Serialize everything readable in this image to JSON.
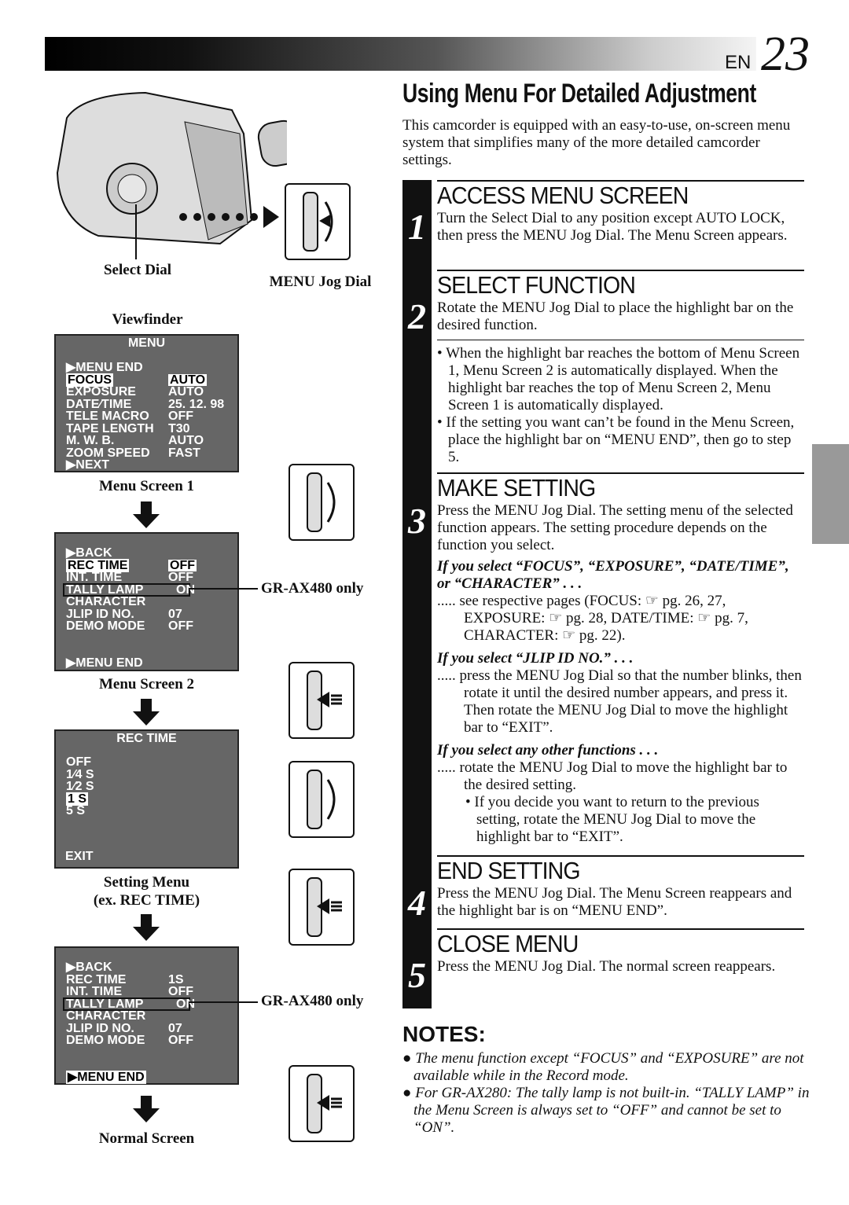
{
  "header": {
    "lang": "EN",
    "page": "23"
  },
  "title": "Using Menu For Detailed Adjustment",
  "intro": "This camcorder is equipped with an easy-to-use, on-screen menu system that simplifies many of the more detailed camcorder settings.",
  "figure": {
    "select_dial": "Select Dial",
    "menu_jog_dial": "MENU Jog Dial",
    "viewfinder": "Viewfinder",
    "screen1": {
      "title": "MENU",
      "rows": [
        [
          "▶MENU  END",
          ""
        ],
        [
          "FOCUS",
          "AUTO"
        ],
        [
          "EXPOSURE",
          "AUTO"
        ],
        [
          "DATE⁄TIME",
          "25. 12. 98"
        ],
        [
          "TELE  MACRO",
          "OFF"
        ],
        [
          "TAPE  LENGTH",
          "T30"
        ],
        [
          "M. W. B.",
          "AUTO"
        ],
        [
          "ZOOM SPEED",
          "FAST"
        ],
        [
          "▶NEXT",
          ""
        ]
      ],
      "caption": "Menu Screen 1"
    },
    "screen2": {
      "rows": [
        [
          "▶BACK",
          ""
        ],
        [
          "REC  TIME",
          "OFF"
        ],
        [
          "INT.  TIME",
          "OFF"
        ],
        [
          "TALLY  LAMP",
          "ON"
        ],
        [
          "CHARACTER",
          ""
        ],
        [
          "JLIP  ID  NO.",
          "07"
        ],
        [
          "DEMO  MODE",
          "OFF"
        ]
      ],
      "end": "▶MENU  END",
      "caption": "Menu Screen 2",
      "callout": "GR-AX480 only"
    },
    "screen3": {
      "title": "REC  TIME",
      "rows": [
        "OFF",
        "1⁄4  S",
        "1⁄2  S",
        "1  S",
        "5  S"
      ],
      "end": "EXIT",
      "caption1": "Setting Menu",
      "caption2": "(ex. REC TIME)"
    },
    "screen4": {
      "rows": [
        [
          "▶BACK",
          ""
        ],
        [
          "REC  TIME",
          "1S"
        ],
        [
          "INT.  TIME",
          "OFF"
        ],
        [
          "TALLY  LAMP",
          "ON"
        ],
        [
          "CHARACTER",
          ""
        ],
        [
          "JLIP  ID  NO.",
          "07"
        ],
        [
          "DEMO  MODE",
          "OFF"
        ]
      ],
      "end": "▶MENU  END",
      "callout": "GR-AX480 only"
    },
    "normal": "Normal Screen"
  },
  "steps": [
    {
      "num": "1",
      "heading": "ACCESS MENU SCREEN",
      "text": "Turn the Select Dial to any position except AUTO LOCK, then press the MENU Jog Dial. The Menu Screen appears."
    },
    {
      "num": "2",
      "heading": "SELECT FUNCTION",
      "text": "Rotate the MENU Jog Dial to place the highlight bar on the desired function.",
      "bullets": [
        "When the highlight bar reaches the bottom of Menu Screen 1, Menu Screen 2 is automatically displayed. When the highlight bar reaches the top of Menu Screen 2, Menu Screen 1 is automatically displayed.",
        "If the setting you want can’t be found in the Menu Screen, place the highlight bar on “MENU END”, then go to step 5."
      ]
    },
    {
      "num": "3",
      "heading": "MAKE SETTING",
      "text": "Press the MENU Jog Dial. The setting menu of the selected function appears. The setting procedure depends on the function you select.",
      "cases": [
        {
          "head": "If you select “FOCUS”, “EXPOSURE”, “DATE/TIME”, or “CHARACTER” . . .",
          "text": "..... see respective pages (FOCUS: ☞ pg. 26, 27, EXPOSURE: ☞ pg. 28, DATE/TIME: ☞ pg. 7, CHARACTER: ☞ pg. 22)."
        },
        {
          "head": "If you select “JLIP ID NO.” . . .",
          "text": "..... press the MENU Jog Dial so that the number blinks, then rotate it until the desired number appears, and press it. Then rotate the MENU Jog Dial to move the highlight bar to “EXIT”."
        },
        {
          "head": "If you select any other functions . . .",
          "text": "..... rotate the MENU Jog Dial to move the highlight bar to the desired setting.",
          "bullet": "If you decide you want to return to the previous setting, rotate the MENU Jog Dial to move the highlight bar to “EXIT”."
        }
      ]
    },
    {
      "num": "4",
      "heading": "END SETTING",
      "text": "Press the MENU Jog Dial. The Menu Screen reappears and the highlight bar is on “MENU END”."
    },
    {
      "num": "5",
      "heading": "CLOSE MENU",
      "text": "Press the MENU Jog Dial. The normal screen reappears."
    }
  ],
  "notes": {
    "heading": "NOTES:",
    "items": [
      "The menu function except “FOCUS” and “EXPOSURE” are not available while in the Record mode.",
      "For GR-AX280: The tally lamp is not built-in. “TALLY LAMP” in the Menu Screen is always set to “OFF” and cannot be set to “ON”."
    ]
  }
}
